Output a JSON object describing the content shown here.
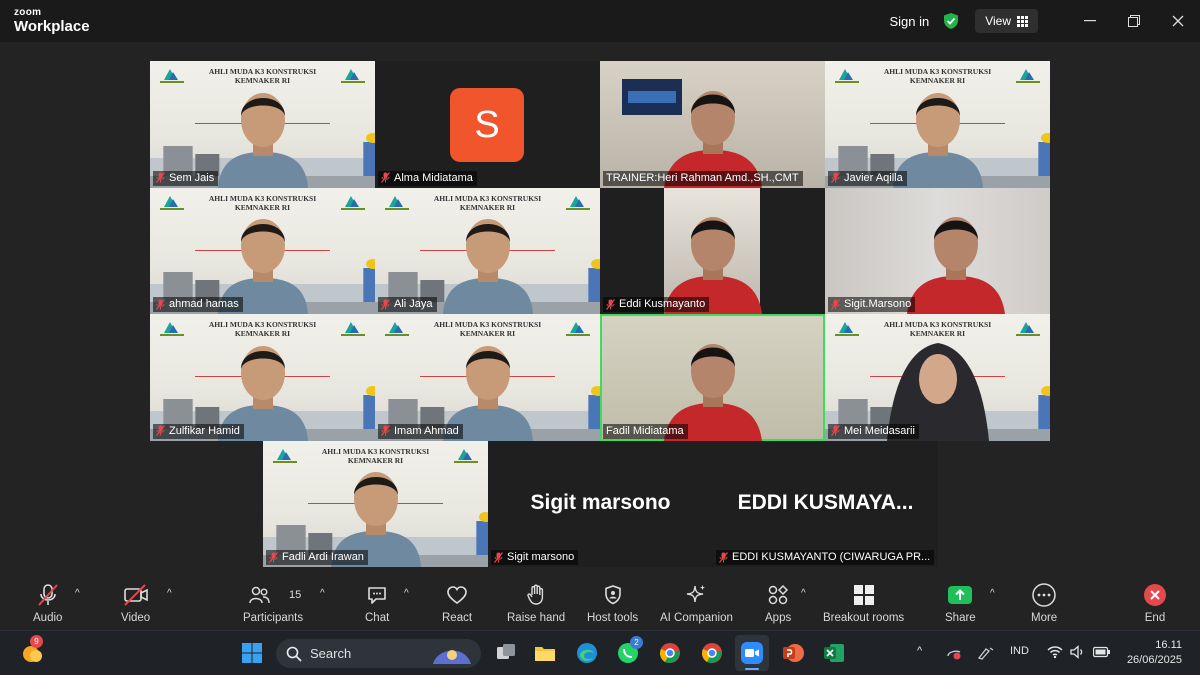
{
  "app": {
    "brand_top": "zoom",
    "brand_bottom": "Workplace"
  },
  "titlebar": {
    "sign_in": "Sign in",
    "view": "View"
  },
  "gallery": {
    "banner_line1": "AHLI MUDA K3 KONSTRUKSI",
    "banner_line2": "KEMNAKER RI",
    "avatar_letter": "S",
    "participants": [
      {
        "name": "Sem Jais"
      },
      {
        "name": "Alma Midiatama"
      },
      {
        "name": "TRAINER:Heri Rahman Amd.,SH.,CMT"
      },
      {
        "name": "Javier Aqilla"
      },
      {
        "name": "ahmad hamas"
      },
      {
        "name": "Ali Jaya"
      },
      {
        "name": "Eddi Kusmayanto"
      },
      {
        "name": "Sigit.Marsono"
      },
      {
        "name": "Zulfikar Hamid"
      },
      {
        "name": "Imam Ahmad"
      },
      {
        "name": "Fadil Midiatama"
      },
      {
        "name": "Mei Meidasarii"
      },
      {
        "name": "Fadli Ardi Irawan"
      },
      {
        "name": "Sigit marsono",
        "big": "Sigit marsono"
      },
      {
        "name": "EDDI KUSMAYANTO (CIWARUGA PR...",
        "big": "EDDI  KUSMAYA..."
      }
    ]
  },
  "toolbar": {
    "audio": "Audio",
    "video": "Video",
    "participants": "Participants",
    "participants_count": "15",
    "chat": "Chat",
    "react": "React",
    "raise_hand": "Raise hand",
    "host_tools": "Host tools",
    "ai_companion": "AI Companion",
    "apps": "Apps",
    "breakout_rooms": "Breakout rooms",
    "share": "Share",
    "more": "More",
    "end": "End"
  },
  "taskbar": {
    "weather_badge": "9",
    "search": "Search",
    "whatsapp_badge": "2",
    "tray_lang": "IND",
    "time": "16.11",
    "date": "26/06/2025"
  },
  "colors": {
    "accent_green": "#3ddc5c",
    "avatar_orange": "#f0552b",
    "end_red": "#e5484d"
  }
}
